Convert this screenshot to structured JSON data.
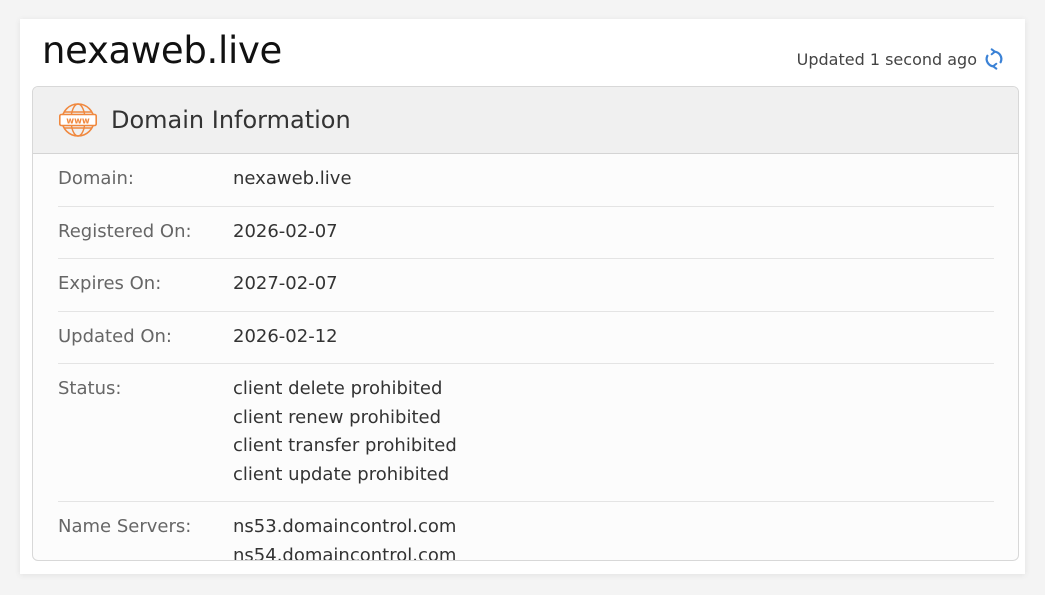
{
  "domain_title": "nexaweb.live",
  "updated_text": "Updated 1 second ago",
  "panel": {
    "title": "Domain Information",
    "icon": "www-globe-icon"
  },
  "rows": {
    "domain": {
      "label": "Domain:",
      "value": "nexaweb.live"
    },
    "registered": {
      "label": "Registered On:",
      "value": "2026-02-07"
    },
    "expires": {
      "label": "Expires On:",
      "value": "2027-02-07"
    },
    "updated": {
      "label": "Updated On:",
      "value": "2026-02-12"
    },
    "status": {
      "label": "Status:",
      "values": [
        "client delete prohibited",
        "client renew prohibited",
        "client transfer prohibited",
        "client update prohibited"
      ]
    },
    "nameservers": {
      "label": "Name Servers:",
      "values": [
        "ns53.domaincontrol.com",
        "ns54.domaincontrol.com"
      ]
    }
  },
  "colors": {
    "accent_orange": "#f0883e",
    "refresh_blue": "#3b82d6"
  }
}
